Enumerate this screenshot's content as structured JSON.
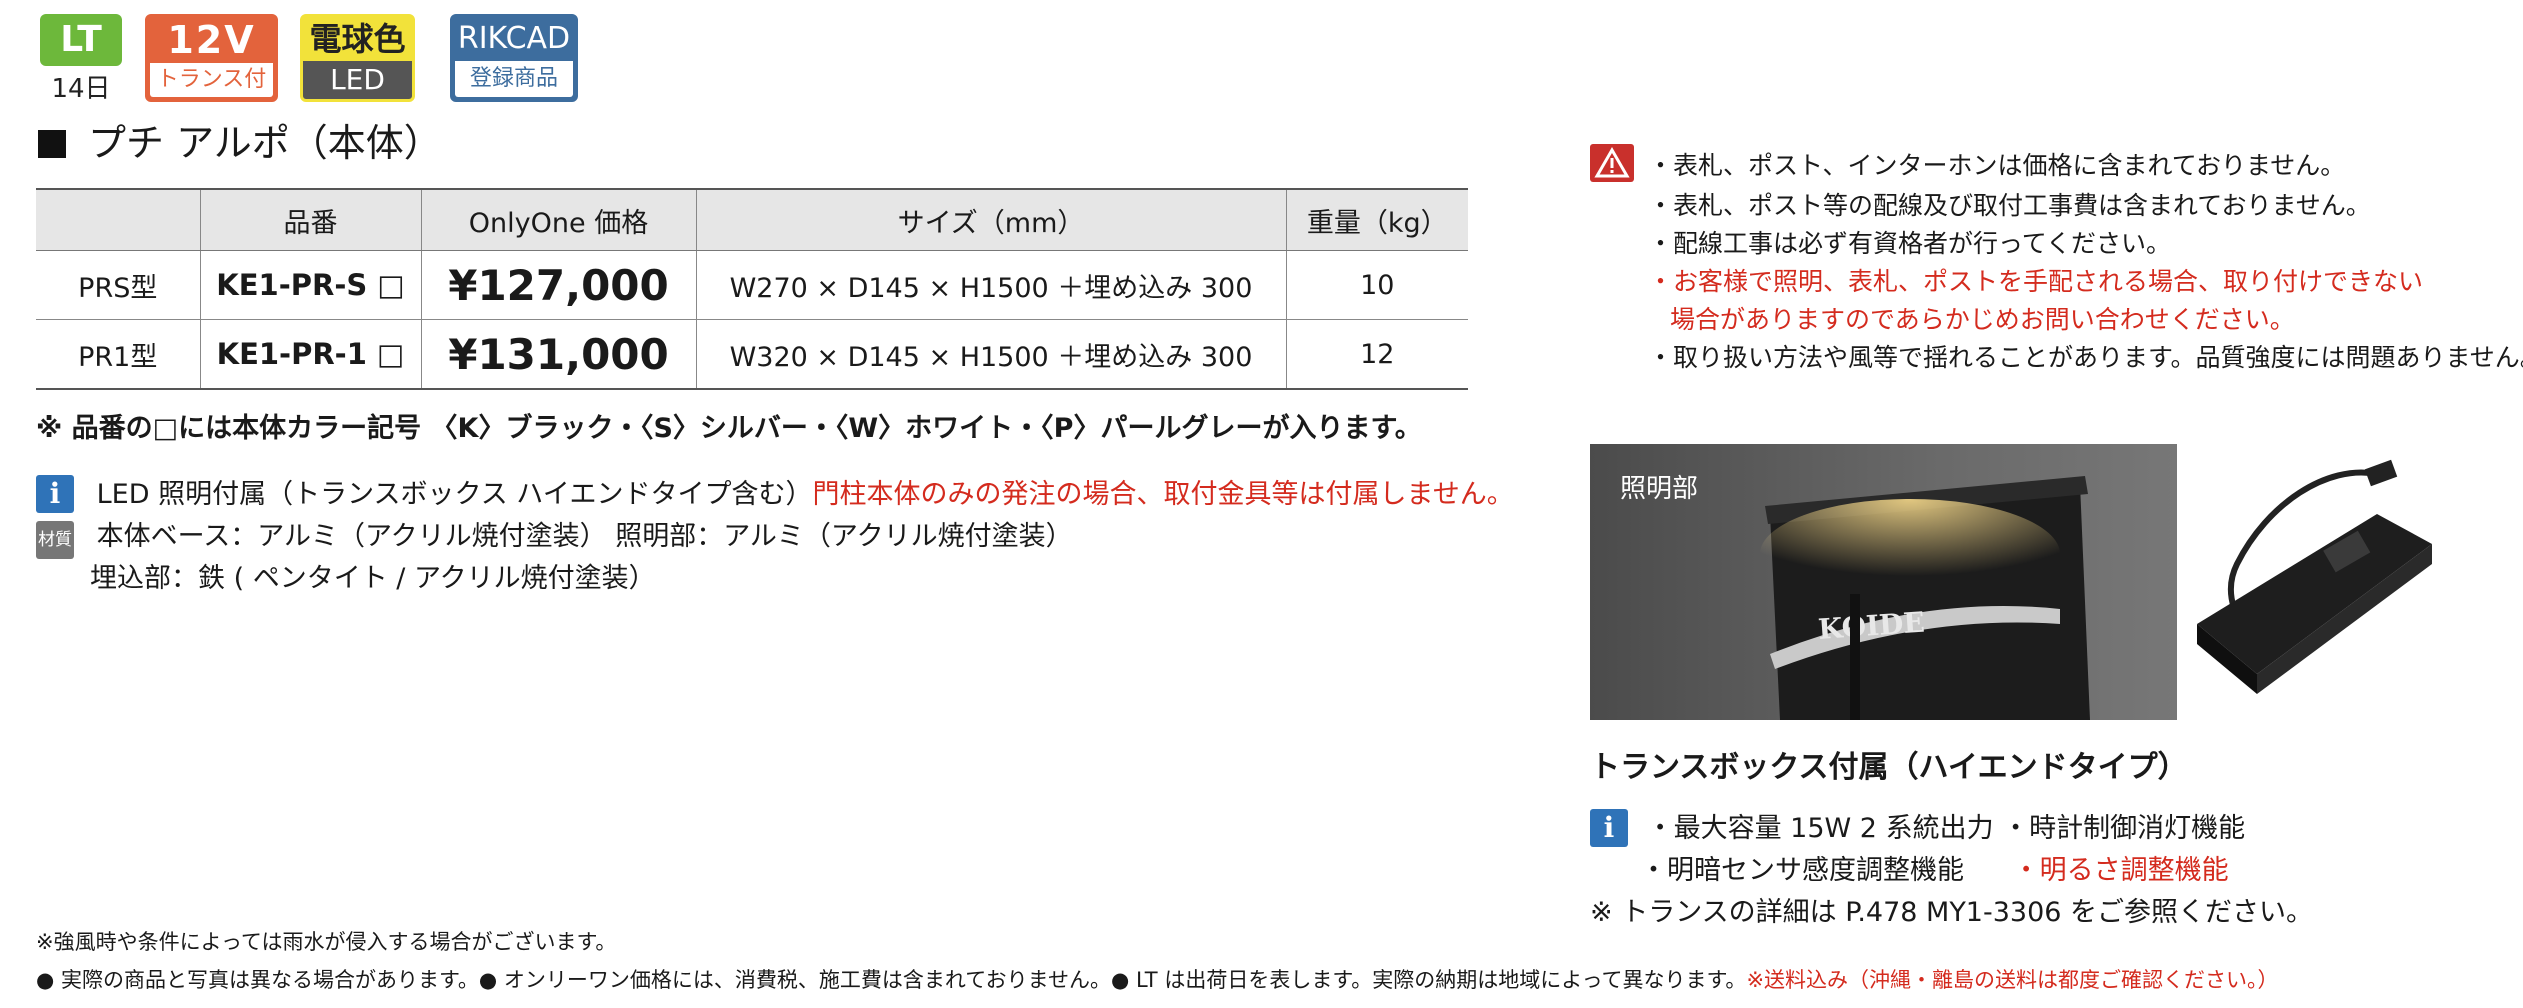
{
  "badges": {
    "lt": "LT",
    "lt_sub": "14日",
    "v12": "12V",
    "v12_sub": "トランス付",
    "bulb": "電球色",
    "bulb_sub": "LED",
    "rikcad": "RIKCAD",
    "rikcad_sub": "登録商品"
  },
  "title": "プチ アルポ（本体）",
  "table": {
    "headers": [
      "",
      "品番",
      "OnlyOne 価格",
      "サイズ（mm）",
      "重量（kg）"
    ],
    "rows": [
      {
        "type": "PRS型",
        "code": "KE1-PR-S □",
        "price": "¥127,000",
        "size": "W270 × D145 × H1500 ＋埋め込み 300",
        "weight": "10"
      },
      {
        "type": "PR1型",
        "code": "KE1-PR-1 □",
        "price": "¥131,000",
        "size": "W320 × D145 × H1500 ＋埋め込み 300",
        "weight": "12"
      }
    ]
  },
  "color_note": "※ 品番の□には本体カラー記号 〈K〉ブラック・〈S〉シルバー・〈W〉ホワイト・〈P〉パールグレーが入ります。",
  "info": {
    "icon_label": "i",
    "led_text": "LED 照明付属（トランスボックス ハイエンドタイプ含む）",
    "led_warning": "門柱本体のみの発注の場合、取付金具等は付属しません。",
    "material_icon": "材質",
    "material1": "本体ベース：アルミ（アクリル焼付塗装） 照明部：アルミ（アクリル焼付塗装）",
    "material2": "埋込部：鉄 ( ペンタイト / アクリル焼付塗装）"
  },
  "caution": {
    "items": [
      "・表札、ポスト、インターホンは価格に含まれておりません。",
      "・表札、ポスト等の配線及び取付工事費は含まれておりません。",
      "・配線工事は必ず有資格者が行ってください。"
    ],
    "red1": "・お客様で照明、表札、ポストを手配される場合、取り付けできない",
    "red2": "場合がありますのであらかじめお問い合わせください。",
    "last": "・取り扱い方法や風等で揺れることがあります。品質強度には問題ありません。"
  },
  "photo": {
    "label": "照明部",
    "plate_text": "KOIDE"
  },
  "transbox": {
    "heading": "トランスボックス付属（ハイエンドタイプ）",
    "line1": "・最大容量 15W  2 系統出力  ・時計制御消灯機能",
    "line2a": "・明暗センサ感度調整機能",
    "line2b": "・明るさ調整機能",
    "ref": "※ トランスの詳細は P.478  MY1-3306 をご参照ください。"
  },
  "footer": {
    "rain": "※強風時や条件によっては雨水が侵入する場合がございます。",
    "main": "● 実際の商品と写真は異なる場合があります。● オンリーワン価格には、消費税、施工費は含まれておりません。● LT は出荷日を表します。実際の納期は地域によって異なります。",
    "red": "※送料込み（沖縄・離島の送料は都度ご確認ください。）"
  },
  "colors": {
    "accent_red": "#d42b1e",
    "info_blue": "#2f73b8",
    "lt_green": "#6db83b",
    "v12_orange": "#e3633c",
    "bulb_yellow": "#f2e23a",
    "rikcad_blue": "#3d6d9e"
  }
}
